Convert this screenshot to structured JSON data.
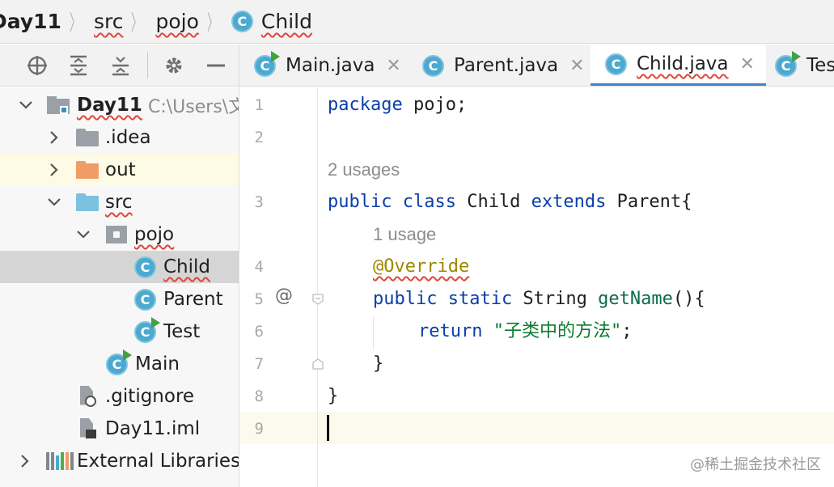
{
  "breadcrumb": {
    "items": [
      "Day11",
      "src",
      "pojo"
    ],
    "current": "Child",
    "class_icon_letter": "C"
  },
  "project_toolbar": {
    "icons": [
      "locate-icon",
      "expand-all-icon",
      "collapse-all-icon",
      "gear-icon",
      "minimize-icon"
    ]
  },
  "tree": {
    "root": {
      "name": "Day11",
      "path": "C:\\Users\\文"
    },
    "items": [
      {
        "label": ".idea",
        "kind": "folder"
      },
      {
        "label": "out",
        "kind": "excluded-folder"
      },
      {
        "label": "src",
        "kind": "source-folder"
      },
      {
        "label": "pojo",
        "kind": "package"
      },
      {
        "label": "Child",
        "kind": "class"
      },
      {
        "label": "Parent",
        "kind": "class"
      },
      {
        "label": "Test",
        "kind": "runnable-class"
      },
      {
        "label": "Main",
        "kind": "runnable-class"
      },
      {
        "label": ".gitignore",
        "kind": "ignored-file"
      },
      {
        "label": "Day11.iml",
        "kind": "module-file"
      },
      {
        "label": "External Libraries",
        "kind": "libraries"
      }
    ]
  },
  "tabs": [
    {
      "label": "Main.java",
      "active": false,
      "runnable": true
    },
    {
      "label": "Parent.java",
      "active": false,
      "runnable": false
    },
    {
      "label": "Child.java",
      "active": true,
      "runnable": false
    },
    {
      "label": "Tes",
      "active": false,
      "runnable": true
    }
  ],
  "editor": {
    "line_numbers": [
      "1",
      "2",
      "3",
      "4",
      "5",
      "6",
      "7",
      "8",
      "9"
    ],
    "hints": {
      "class_usages": "2 usages",
      "method_usages": "1 usage"
    },
    "code": {
      "l1_kw": "package",
      "l1_rest": " pojo;",
      "l3_kw": "public class",
      "l3_mid": " Child ",
      "l3_kw2": "extends",
      "l3_rest": " Parent{",
      "l4_ann": "@Override",
      "l5_kw": "public static",
      "l5_type": " String ",
      "l5_fn": "getName",
      "l5_rest": "(){",
      "l6_kw": "return",
      "l6_str": " \"子类中的方法\"",
      "l6_end": ";",
      "l7": "}",
      "l8": "}"
    },
    "gutter_mark": "@",
    "current_line": "9"
  },
  "watermark": "@稀土掘金技术社区",
  "colors": {
    "accent": "#4083c9",
    "class_icon": "#4ca9cf",
    "keyword": "#0b3ea8",
    "string": "#0a7a2e",
    "annotation": "#9e8800"
  }
}
